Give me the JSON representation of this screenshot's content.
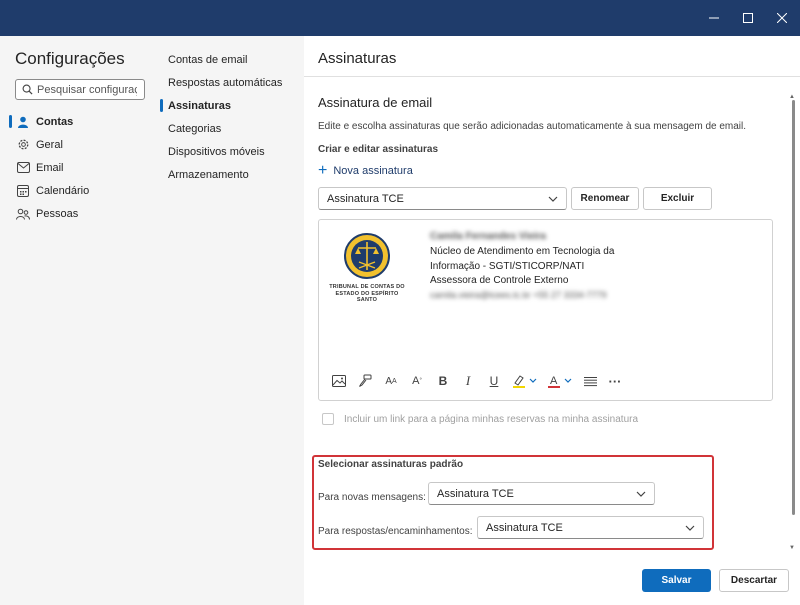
{
  "window": {
    "controls": {
      "minimize": "minimize-icon",
      "maximize": "maximize-icon",
      "close": "close-icon"
    },
    "titlebar_color": "#1f3c6b"
  },
  "sidebar": {
    "title": "Configurações",
    "search_placeholder": "Pesquisar configuraçõ",
    "items": [
      {
        "label": "Contas",
        "icon": "person-icon",
        "active": true
      },
      {
        "label": "Geral",
        "icon": "gear-icon",
        "active": false
      },
      {
        "label": "Email",
        "icon": "mail-icon",
        "active": false
      },
      {
        "label": "Calendário",
        "icon": "calendar-icon",
        "active": false
      },
      {
        "label": "Pessoas",
        "icon": "people-icon",
        "active": false
      }
    ]
  },
  "submenu": {
    "items": [
      {
        "label": "Contas de email",
        "active": false
      },
      {
        "label": "Respostas automáticas",
        "active": false
      },
      {
        "label": "Assinaturas",
        "active": true
      },
      {
        "label": "Categorias",
        "active": false
      },
      {
        "label": "Dispositivos móveis",
        "active": false
      },
      {
        "label": "Armazenamento",
        "active": false
      }
    ]
  },
  "main": {
    "page_title": "Assinaturas",
    "section_title": "Assinatura de email",
    "description": "Edite e escolha assinaturas que serão adicionadas automaticamente à sua mensagem de email.",
    "create_edit_heading": "Criar e editar assinaturas",
    "new_signature_label": "Nova assinatura",
    "signature_select_value": "Assinatura TCE",
    "rename_label": "Renomear",
    "delete_label": "Excluir",
    "signature": {
      "logo_text_line1": "TRIBUNAL DE CONTAS DO",
      "logo_text_line2": "ESTADO DO ESPÍRITO SANTO",
      "name_redacted": "Camila Fernandes Vieira",
      "line1": "Núcleo de Atendimento em Tecnologia da",
      "line2": "Informação - SGTI/STICORP/NATI",
      "line3": "Assessora de Controle Externo",
      "contact_redacted": "camila.vieira@tcees.tc.br +55 27 3334-7779"
    },
    "toolbar_icons": [
      "image-icon",
      "format-painter-icon",
      "font-size-icon",
      "superscript-icon",
      "bold-icon",
      "italic-icon",
      "underline-icon",
      "highlight-icon",
      "font-color-icon",
      "list-icon",
      "more-icon"
    ],
    "reservations_checkbox_label": "Incluir um link para a página minhas reservas na minha assinatura",
    "defaults": {
      "title": "Selecionar assinaturas padrão",
      "new_messages_label": "Para novas mensagens:",
      "new_messages_value": "Assinatura TCE",
      "replies_label": "Para respostas/encaminhamentos:",
      "replies_value": "Assinatura TCE"
    }
  },
  "footer": {
    "save_label": "Salvar",
    "discard_label": "Descartar"
  },
  "colors": {
    "accent": "#0f6cbd",
    "highlight_border": "#d13438"
  }
}
